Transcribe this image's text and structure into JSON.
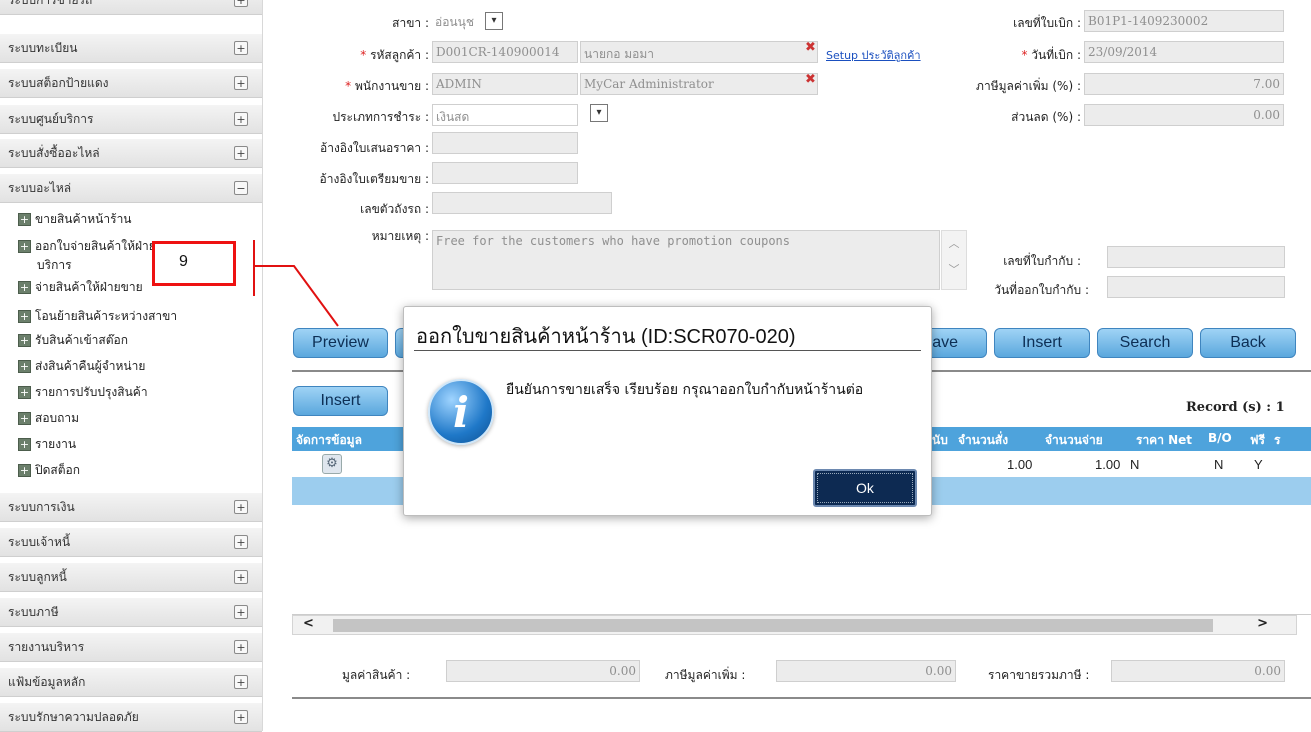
{
  "sidebar": {
    "items_top": [
      {
        "label": "ระบบการขายรถ",
        "state": "collapsed"
      },
      {
        "label": "ระบบทะเบียน",
        "state": "collapsed"
      },
      {
        "label": "ระบบสต็อกป้ายแดง",
        "state": "collapsed"
      },
      {
        "label": "ระบบศูนย์บริการ",
        "state": "collapsed"
      },
      {
        "label": "ระบบสั่งซื้ออะไหล่",
        "state": "collapsed"
      },
      {
        "label": "ระบบอะไหล่",
        "state": "expanded"
      }
    ],
    "sub_items": [
      "ขายสินค้าหน้าร้าน",
      "ออกใบจ่ายสินค้าให้ฝ่าย",
      "บริการ",
      "จ่ายสินค้าให้ฝ่ายขาย",
      "โอนย้ายสินค้าระหว่างสาขา",
      "รับสินค้าเข้าสต๊อก",
      "ส่งสินค้าคืนผู้จำหน่าย",
      "รายการปรับปรุงสินค้า",
      "สอบถาม",
      "รายงาน",
      "ปิดสต็อก"
    ],
    "items_bottom": [
      "ระบบการเงิน",
      "ระบบเจ้าหนี้",
      "ระบบลูกหนี้",
      "ระบบภาษี",
      "รายงานบริหาร",
      "แฟ้มข้อมูลหลัก",
      "ระบบรักษาความปลอดภัย"
    ],
    "plus_glyph": "+",
    "minus_glyph": "−"
  },
  "form": {
    "branch_label": "สาขา :",
    "branch_value": "อ่อนนุช",
    "customer_label": "รหัสลูกค้า :",
    "customer_code": "D001CR-140900014",
    "customer_name": "นายกอ มอมา",
    "setup_link": "Setup ประวัติลูกค้า",
    "salesman_label": "พนักงานขาย :",
    "salesman_code": "ADMIN",
    "salesman_name": "MyCar Administrator",
    "payment_label": "ประเภทการชำระ :",
    "payment_value": "เงินสด",
    "quote_ref_label": "อ้างอิงใบเสนอราคา :",
    "prep_ref_label": "อ้างอิงใบเตรียมขาย :",
    "chassis_label": "เลขตัวถังรถ :",
    "remark_label": "หมายเหตุ :",
    "remark_value": "Free for the customers who have promotion coupons",
    "bill_no_label": "เลขที่ใบเบิก :",
    "bill_no_value": "B01P1-1409230002",
    "bill_date_label": "วันที่เบิก :",
    "bill_date_value": "23/09/2014",
    "vat_label": "ภาษีมูลค่าเพิ่ม (%) :",
    "vat_value": "7.00",
    "discount_label": "ส่วนลด (%) :",
    "discount_value": "0.00",
    "tax_inv_label": "เลขที่ใบกำกับ :",
    "tax_inv_date_label": "วันที่ออกใบกำกับ :",
    "required_mark": "*"
  },
  "buttons": {
    "preview": "Preview",
    "save_partial": "ave",
    "insert": "Insert",
    "search": "Search",
    "back": "Back",
    "grid_insert": "Insert"
  },
  "grid": {
    "record_count": "Record (s) : 1",
    "headers": [
      "จัดการข้อมูล",
      "ยนับ",
      "จำนวนสั่ง",
      "จำนวนจ่าย",
      "ราคา Net",
      "B/O",
      "ฟรี",
      "ร"
    ],
    "row": {
      "qty_order": "1.00",
      "qty_issue": "1.00",
      "net_price": "N",
      "bo": "N",
      "free": "Y"
    },
    "scroll_left": "<",
    "scroll_right": ">"
  },
  "totals": {
    "goods_label": "มูลค่าสินค้า :",
    "goods_value": "0.00",
    "vat_label": "ภาษีมูลค่าเพิ่ม :",
    "vat_value": "0.00",
    "grand_label": "ราคาขายรวมภาษี :",
    "grand_value": "0.00"
  },
  "annotation": {
    "number": "9",
    "color": "#e11111"
  },
  "dialog": {
    "title": "ออกใบขายสินค้าหน้าร้าน (ID:SCR070-020)",
    "message": "ยืนยันการขายเสร็จ เรียบร้อย กรุณาออกใบกำกับหน้าร้านต่อ",
    "icon": "i",
    "ok": "Ok"
  },
  "colors": {
    "header_blue": "#4ea3dc",
    "selected_row": "#9ccdee",
    "button_blue": "#5aa7dd"
  }
}
